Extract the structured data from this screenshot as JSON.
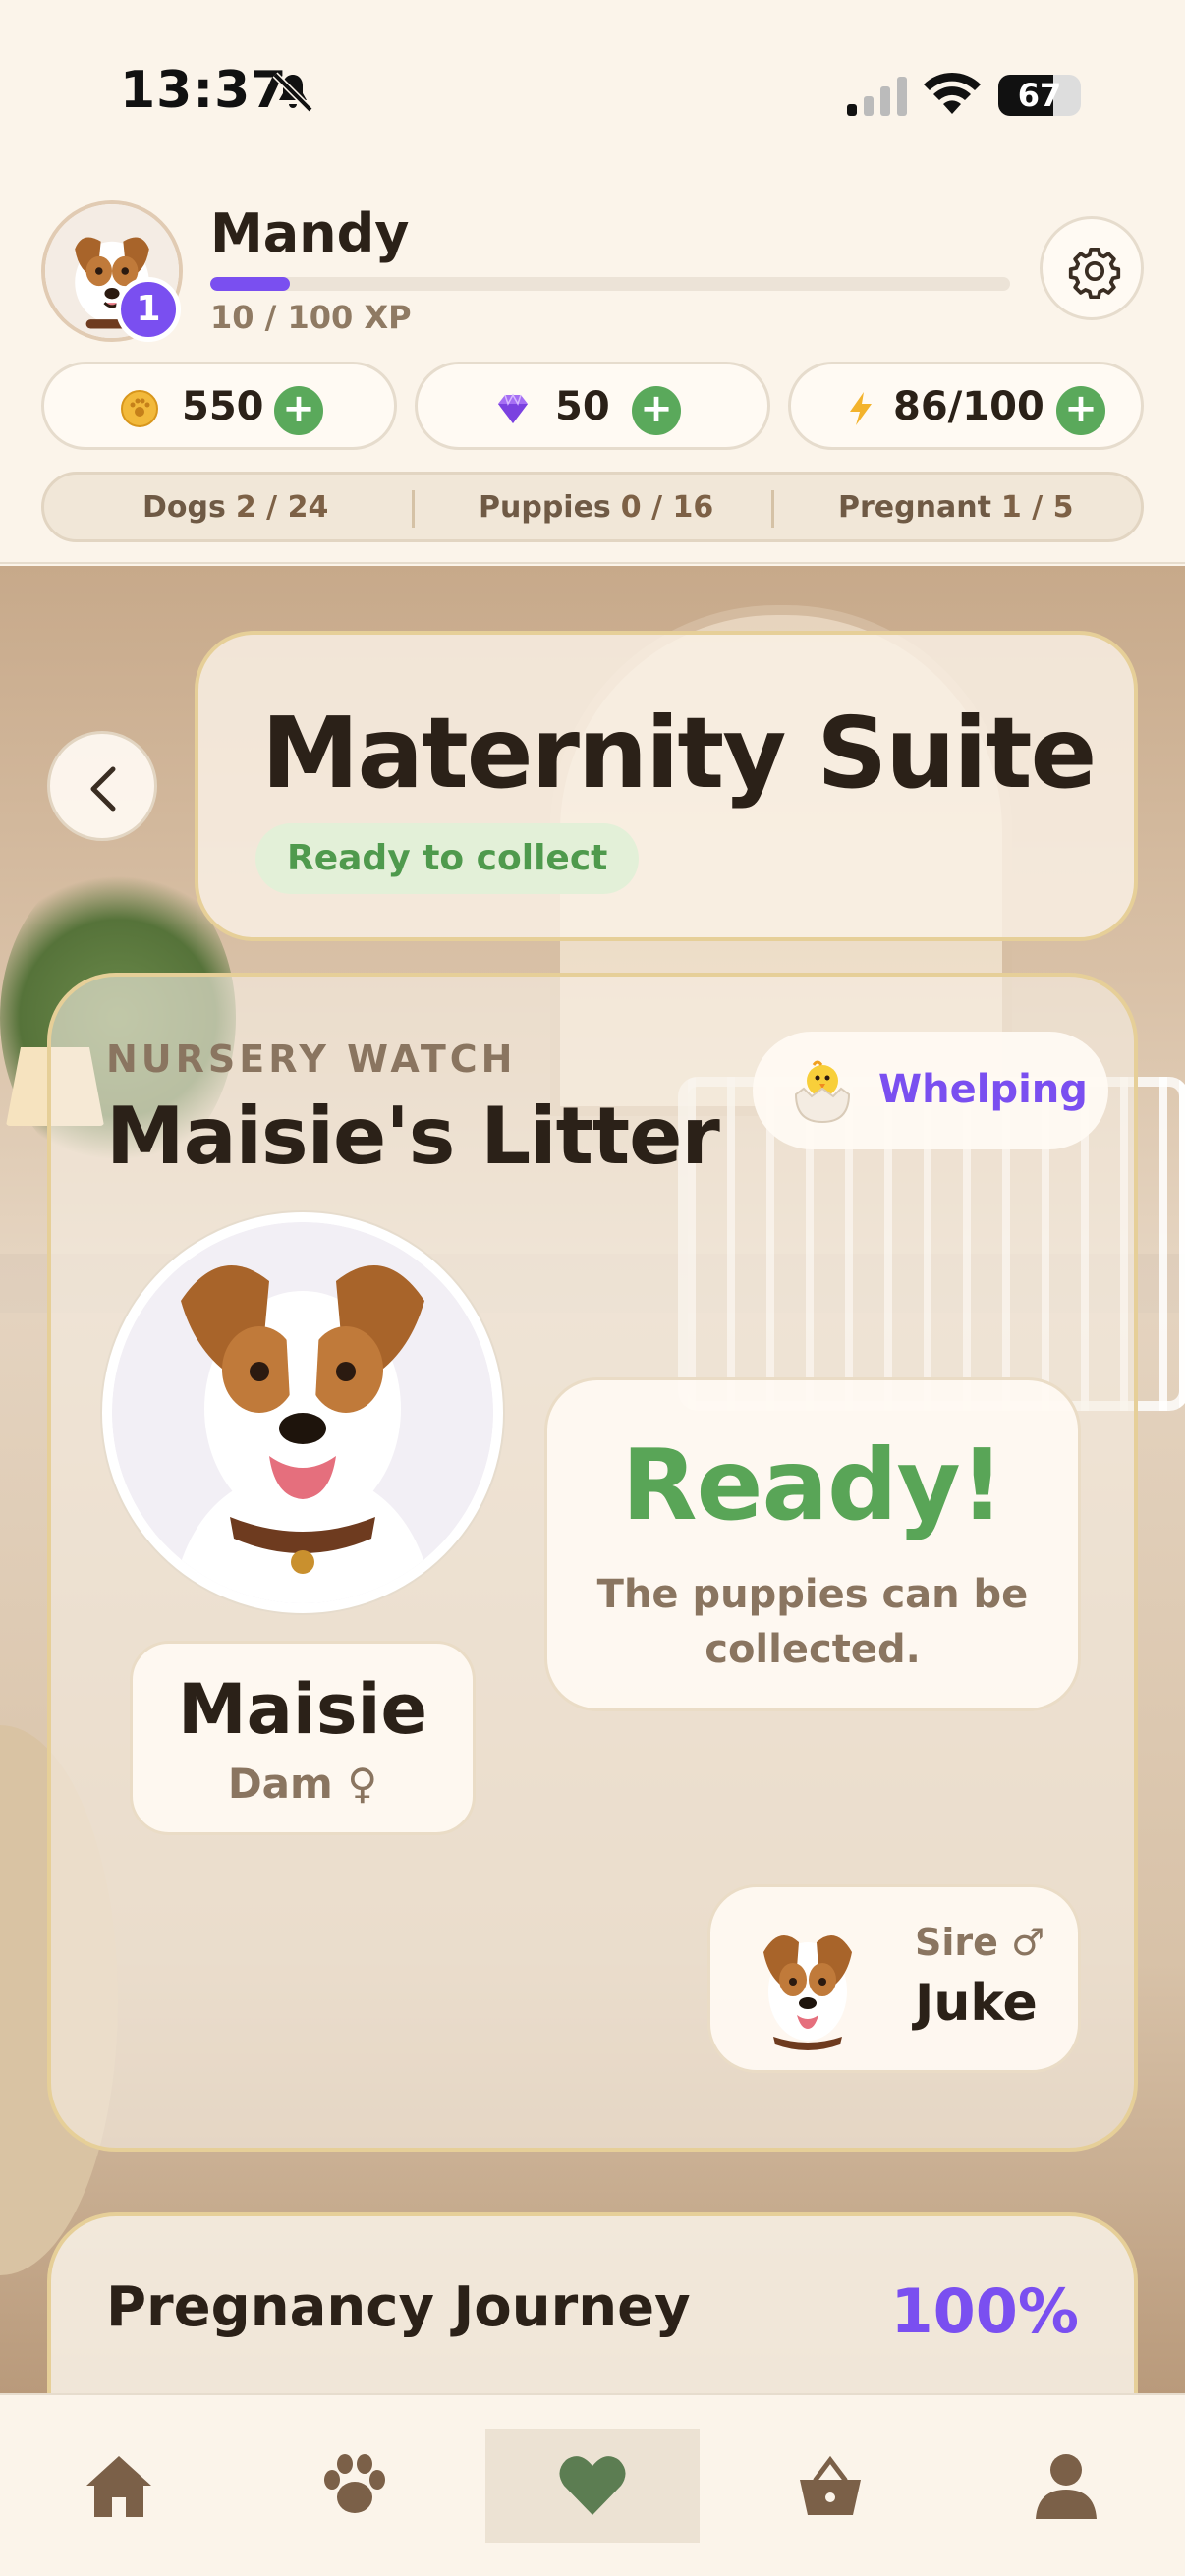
{
  "status_bar": {
    "time": "13:37",
    "battery_percent": 67,
    "battery_label": "67"
  },
  "player": {
    "name": "Mandy",
    "level": "1",
    "xp_text": "10 / 100 XP",
    "xp_fraction": 0.1
  },
  "currencies": [
    {
      "icon": "paw-coin-icon",
      "value": "550"
    },
    {
      "icon": "gem-icon",
      "value": "50"
    },
    {
      "icon": "energy-bolt-icon",
      "value": "86/100"
    }
  ],
  "counts": [
    {
      "label": "Dogs",
      "value": "2 / 24"
    },
    {
      "label": "Puppies",
      "value": "0 / 16"
    },
    {
      "label": "Pregnant",
      "value": "1 / 5"
    }
  ],
  "page": {
    "title": "Maternity Suite",
    "status_pill": "Ready to collect"
  },
  "nursery": {
    "eyebrow": "NURSERY WATCH",
    "title": "Maisie's Litter",
    "stage": "Whelping",
    "dam": {
      "name": "Maisie",
      "role": "Dam ♀"
    },
    "ready": {
      "headline": "Ready!",
      "description": "The puppies can be collected."
    },
    "sire": {
      "role": "Sire ♂",
      "name": "Juke"
    }
  },
  "journey": {
    "title": "Pregnancy Journey",
    "percent": "100%"
  },
  "tabs": [
    {
      "icon": "home-icon",
      "active": false
    },
    {
      "icon": "paw-icon",
      "active": false
    },
    {
      "icon": "heart-icon",
      "active": true
    },
    {
      "icon": "basket-icon",
      "active": false
    },
    {
      "icon": "profile-icon",
      "active": false
    }
  ],
  "colors": {
    "accent": "#7a4ff0",
    "success": "#59a557",
    "background": "#fbf4ea",
    "text_muted": "#8a7560"
  }
}
